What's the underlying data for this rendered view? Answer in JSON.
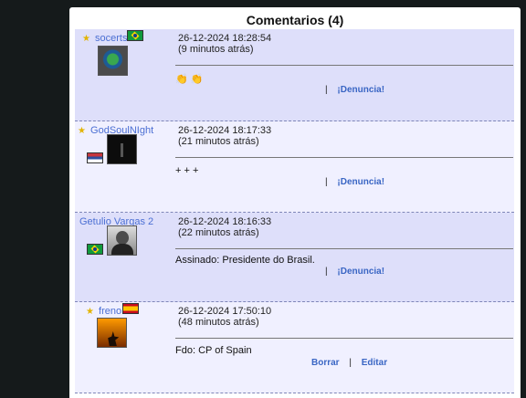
{
  "panel_title": "Comentarios (4)",
  "comments": [
    {
      "user": "socerts",
      "date": "26-12-2024 18:28:54",
      "ago": "(9 minutos atrás)",
      "text": "👏 👏",
      "action": "¡Denuncia!"
    },
    {
      "user": "GodSoulNIght",
      "date": "26-12-2024 18:17:33",
      "ago": "(21 minutos atrás)",
      "text": "+ + +",
      "action": "¡Denuncia!"
    },
    {
      "user": "Getulio Vargas 2",
      "date": "26-12-2024 18:16:33",
      "ago": "(22 minutos atrás)",
      "text": "Assinado: Presidente do Brasil.",
      "action": "¡Denuncia!"
    },
    {
      "user": "freno",
      "date": "26-12-2024 17:50:10",
      "ago": "(48 minutos atrás)",
      "text": "Fdo: CP of Spain",
      "actions": [
        "Borrar",
        "Editar"
      ]
    }
  ],
  "colors": {
    "link": "#3a66c4",
    "row_dark": "#dedffa",
    "row_light": "#f0f0ff"
  }
}
